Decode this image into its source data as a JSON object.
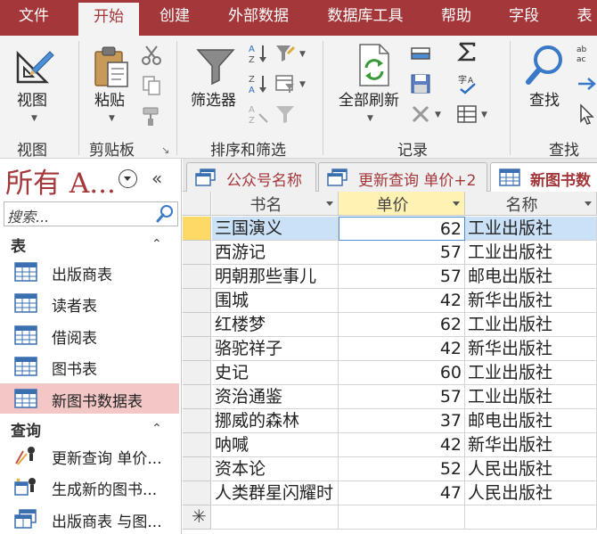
{
  "ribbon_tabs": [
    {
      "label": "文件",
      "active": false
    },
    {
      "label": "开始",
      "active": true
    },
    {
      "label": "创建",
      "active": false
    },
    {
      "label": "外部数据",
      "active": false
    },
    {
      "label": "数据库工具",
      "active": false
    },
    {
      "label": "帮助",
      "active": false
    },
    {
      "label": "字段",
      "active": false
    },
    {
      "label": "表",
      "active": false
    }
  ],
  "ribbon": {
    "view": {
      "button": "视图",
      "group": "视图"
    },
    "clipboard": {
      "paste": "粘贴",
      "group": "剪贴板"
    },
    "sort_filter": {
      "filter": "筛选器",
      "group": "排序和筛选"
    },
    "records": {
      "refresh_all": "全部刷新",
      "group": "记录"
    },
    "find": {
      "button": "查找",
      "group": "查找"
    },
    "accent": "#a4373a"
  },
  "nav": {
    "title": "所有 A...",
    "search_placeholder": "搜索...",
    "sections": [
      {
        "header": "表",
        "items": [
          {
            "label": "出版商表",
            "icon": "table-icon",
            "selected": false
          },
          {
            "label": "读者表",
            "icon": "table-icon",
            "selected": false
          },
          {
            "label": "借阅表",
            "icon": "table-icon",
            "selected": false
          },
          {
            "label": "图书表",
            "icon": "table-icon",
            "selected": false
          },
          {
            "label": "新图书数据表",
            "icon": "table-icon",
            "selected": true
          }
        ]
      },
      {
        "header": "查询",
        "items": [
          {
            "label": "更新查询 单价...",
            "icon": "update-query-icon",
            "selected": false
          },
          {
            "label": "生成新的图书...",
            "icon": "make-table-query-icon",
            "selected": false
          },
          {
            "label": "出版商表 与图...",
            "icon": "select-query-icon",
            "selected": false
          }
        ]
      }
    ]
  },
  "doc_tabs": [
    {
      "label": "公众号名称",
      "active": false
    },
    {
      "label": "更新查询 单价+2",
      "active": false
    },
    {
      "label": "新图书数",
      "active": true
    }
  ],
  "sheet": {
    "columns": [
      "书名",
      "单价",
      "名称"
    ],
    "rows": [
      {
        "name": "三国演义",
        "price": "62",
        "publisher": "工业出版社"
      },
      {
        "name": "西游记",
        "price": "57",
        "publisher": "工业出版社"
      },
      {
        "name": "明朝那些事儿",
        "price": "57",
        "publisher": "邮电出版社"
      },
      {
        "name": "围城",
        "price": "42",
        "publisher": "新华出版社"
      },
      {
        "name": "红楼梦",
        "price": "62",
        "publisher": "工业出版社"
      },
      {
        "name": "骆驼祥子",
        "price": "42",
        "publisher": "新华出版社"
      },
      {
        "name": "史记",
        "price": "60",
        "publisher": "工业出版社"
      },
      {
        "name": "资治通鉴",
        "price": "57",
        "publisher": "工业出版社"
      },
      {
        "name": "挪威的森林",
        "price": "37",
        "publisher": "邮电出版社"
      },
      {
        "name": "呐喊",
        "price": "42",
        "publisher": "新华出版社"
      },
      {
        "name": "资本论",
        "price": "52",
        "publisher": "人民出版社"
      },
      {
        "name": "人类群星闪耀时",
        "price": "47",
        "publisher": "人民出版社"
      }
    ],
    "new_row_marker": "✳"
  }
}
